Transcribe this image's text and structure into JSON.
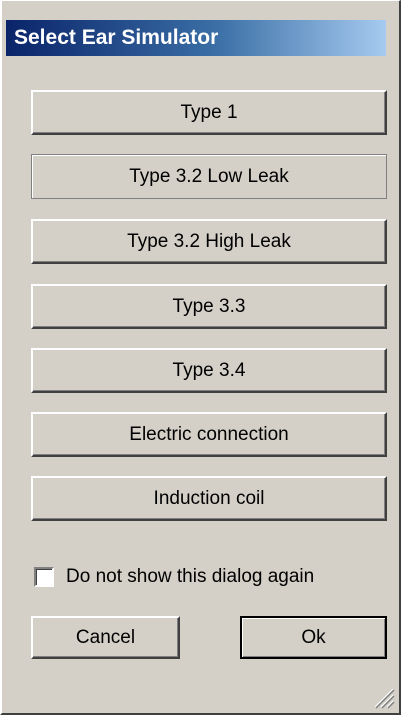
{
  "dialog": {
    "title": "Select Ear Simulator"
  },
  "simulators": [
    {
      "label": "Type 1"
    },
    {
      "label": "Type 3.2 Low Leak"
    },
    {
      "label": "Type 3.2 High Leak"
    },
    {
      "label": "Type 3.3"
    },
    {
      "label": "Type 3.4"
    },
    {
      "label": "Electric connection"
    },
    {
      "label": "Induction coil"
    }
  ],
  "options": {
    "dont_show_label": "Do not show this dialog again",
    "dont_show_checked": false
  },
  "footer": {
    "cancel_label": "Cancel",
    "ok_label": "Ok"
  },
  "icons": {
    "resize_grip": "resize-grip-icon"
  }
}
